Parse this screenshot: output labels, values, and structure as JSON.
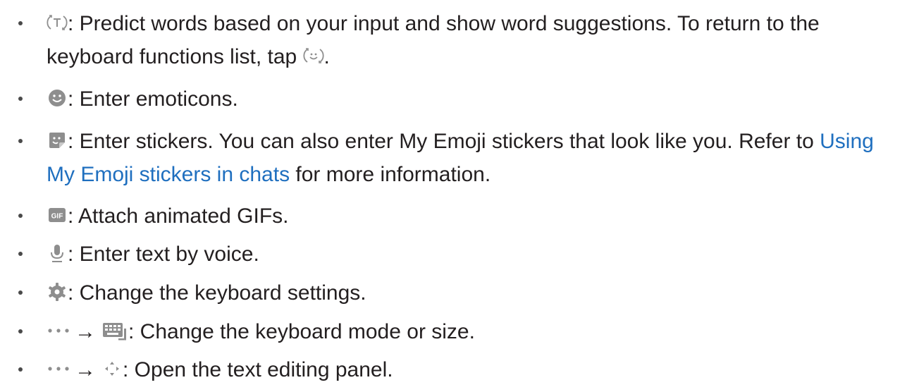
{
  "items": [
    {
      "icon": "predict-text-icon",
      "line1": ": Predict words based on your input and show word suggestions. To return to the",
      "line2_a": "keyboard functions list, tap ",
      "line2_icon": "keyboard-functions-icon",
      "line2_b": "."
    },
    {
      "icon": "emoticon-icon",
      "text": ": Enter emoticons."
    },
    {
      "icon": "sticker-icon",
      "line1_a": ": Enter stickers. You can also enter My Emoji stickers that look like you. Refer to ",
      "line1_link": "Using",
      "line2_link": "My Emoji stickers in chats",
      "line2_b": " for more information."
    },
    {
      "icon": "gif-icon",
      "gif_label": "GIF",
      "text": ": Attach animated GIFs."
    },
    {
      "icon": "microphone-icon",
      "text": ": Enter text by voice."
    },
    {
      "icon": "settings-gear-icon",
      "text": ": Change the keyboard settings."
    },
    {
      "icon_a": "more-options-icon",
      "arrow": "→",
      "icon_b": "keyboard-mode-icon",
      "text": ": Change the keyboard mode or size."
    },
    {
      "icon_a": "more-options-icon",
      "arrow": "→",
      "icon_b": "text-editing-icon",
      "text": ": Open the text editing panel."
    }
  ],
  "colors": {
    "text": "#231f20",
    "link": "#1f6fbf",
    "icon": "#8e8e8e"
  }
}
